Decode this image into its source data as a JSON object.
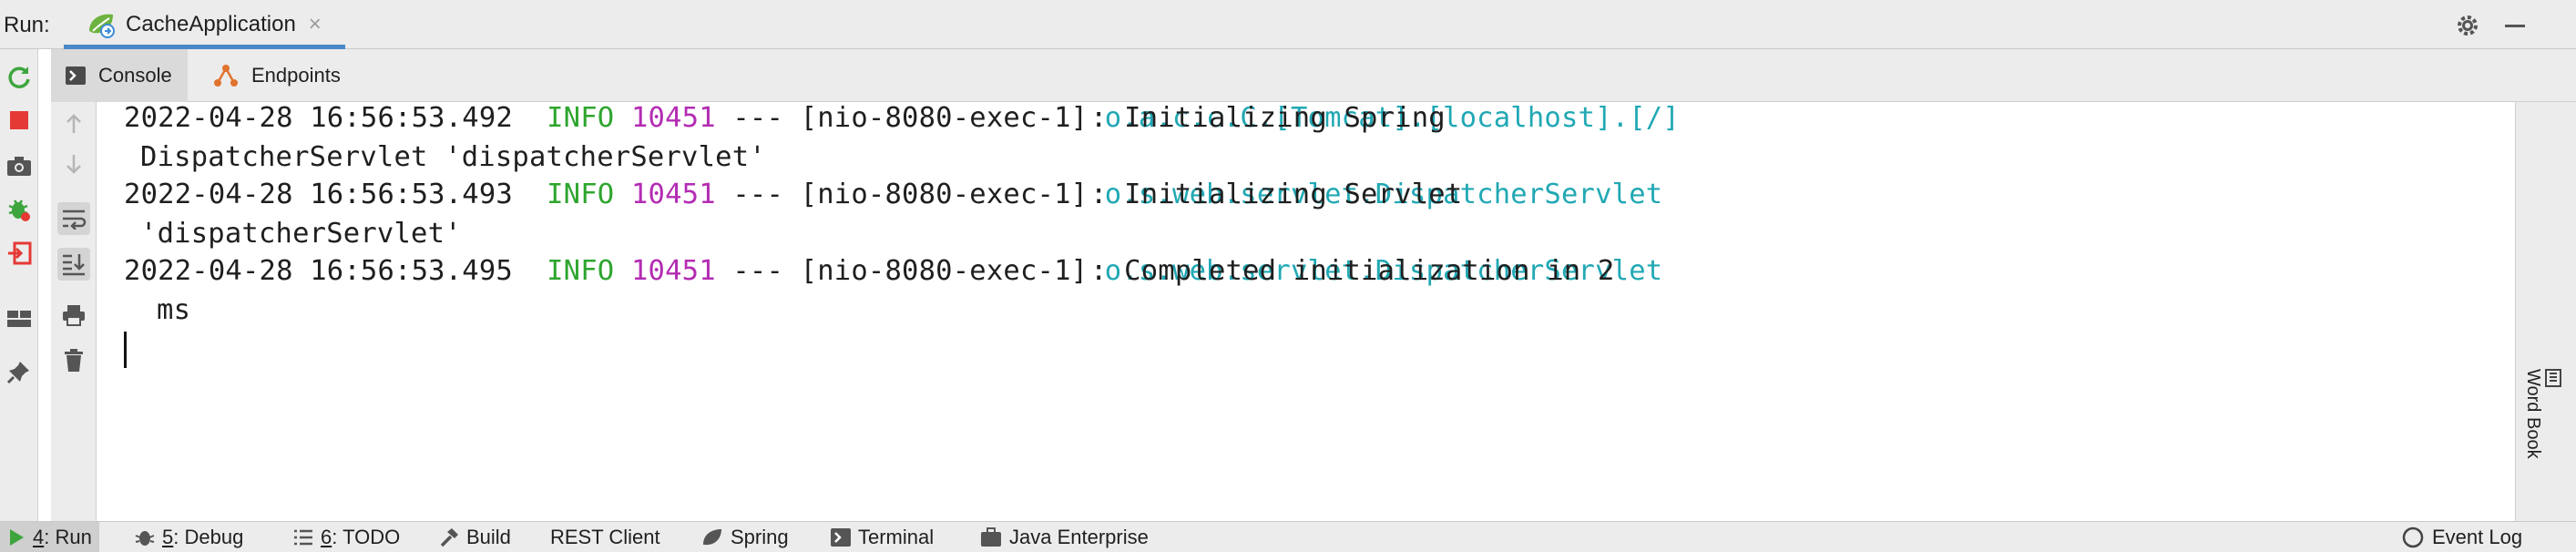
{
  "header": {
    "run_label": "Run:",
    "tab_title": "CacheApplication",
    "tab_close": "×"
  },
  "subtabs": [
    {
      "label": "Console",
      "icon": "console-icon"
    },
    {
      "label": "Endpoints",
      "icon": "endpoints-icon"
    }
  ],
  "console": {
    "lines": [
      {
        "timestamp": "2022-04-28 16:56:53.492",
        "level": "INFO",
        "pid": "10451",
        "sep": "---",
        "thread": "[nio-8080-exec-1]",
        "logger": "o.a.c.c.C.[Tomcat].[localhost].[/]",
        "message": ": Initializing Spring",
        "continuation": "DispatcherServlet 'dispatcherServlet'"
      },
      {
        "timestamp": "2022-04-28 16:56:53.493",
        "level": "INFO",
        "pid": "10451",
        "sep": "---",
        "thread": "[nio-8080-exec-1]",
        "logger": "o.s.web.servlet.DispatcherServlet",
        "message": ": Initializing Servlet",
        "continuation": "'dispatcherServlet'"
      },
      {
        "timestamp": "2022-04-28 16:56:53.495",
        "level": "INFO",
        "pid": "10451",
        "sep": "---",
        "thread": "[nio-8080-exec-1]",
        "logger": "o.s.web.servlet.DispatcherServlet",
        "message": ": Completed initialization in 2",
        "continuation": "ms"
      }
    ]
  },
  "right_sidebar": {
    "word_book_label": "Word Book"
  },
  "bottom_tabs": [
    {
      "mnemonic": "4",
      "label": ": Run",
      "icon": "run-icon",
      "active": true
    },
    {
      "mnemonic": "5",
      "label": ": Debug",
      "icon": "bug-icon",
      "active": false
    },
    {
      "mnemonic": "6",
      "label": ": TODO",
      "icon": "list-icon",
      "active": false
    },
    {
      "mnemonic": "",
      "label": "Build",
      "icon": "hammer-icon",
      "active": false
    },
    {
      "mnemonic": "",
      "label": "REST Client",
      "icon": "",
      "active": false
    },
    {
      "mnemonic": "",
      "label": "Spring",
      "icon": "leaf-icon",
      "active": false
    },
    {
      "mnemonic": "",
      "label": "Terminal",
      "icon": "terminal-icon",
      "active": false
    },
    {
      "mnemonic": "",
      "label": "Java Enterprise",
      "icon": "java-enterprise-icon",
      "active": false
    }
  ],
  "event_log": {
    "label": "Event Log"
  },
  "colors": {
    "accent": "#4a88c7",
    "info_level": "#2ea52e",
    "pid": "#b32cb3",
    "logger": "#21a8b4",
    "stop_red": "#e53935"
  }
}
